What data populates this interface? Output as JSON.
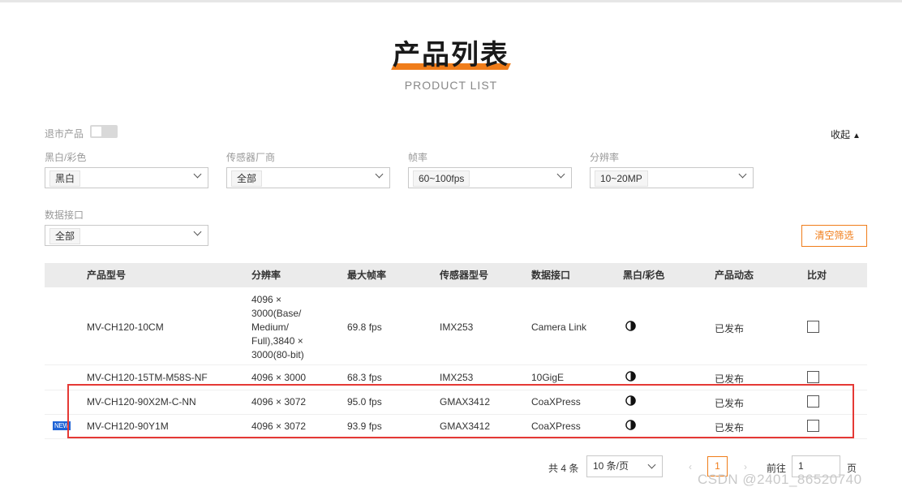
{
  "header": {
    "title": "产品列表",
    "subtitle": "PRODUCT LIST"
  },
  "filters": {
    "discontinued_label": "退市产品",
    "collapse_label": "收起",
    "collapse_icon": "triangle-up-icon",
    "mono_color": {
      "label": "黑白/彩色",
      "value": "黑白"
    },
    "sensor_maker": {
      "label": "传感器厂商",
      "value": "全部"
    },
    "frame_rate": {
      "label": "帧率",
      "value": "60~100fps"
    },
    "resolution": {
      "label": "分辨率",
      "value": "10~20MP"
    },
    "interface": {
      "label": "数据接口",
      "value": "全部"
    },
    "clear_label": "清空筛选"
  },
  "table": {
    "headers": {
      "model": "产品型号",
      "resolution": "分辨率",
      "max_fps": "最大帧率",
      "sensor": "传感器型号",
      "interface": "数据接口",
      "mono_color": "黑白/彩色",
      "status": "产品动态",
      "compare": "比对"
    },
    "rows": [
      {
        "model": "MV-CH120-10CM",
        "resolution_lines": [
          "4096 ×",
          "3000(Base/",
          "Medium/",
          "Full),3840 ×",
          "3000(80-bit)"
        ],
        "max_fps": "69.8 fps",
        "sensor": "IMX253",
        "interface": "Camera Link",
        "status": "已发布"
      },
      {
        "model": "MV-CH120-15TM-M58S-NF",
        "resolution": "4096 × 3000",
        "max_fps": "68.3 fps",
        "sensor": "IMX253",
        "interface": "10GigE",
        "status": "已发布"
      },
      {
        "model": "MV-CH120-90X2M-C-NN",
        "resolution": "4096 × 3072",
        "max_fps": "95.0 fps",
        "sensor": "GMAX3412",
        "interface": "CoaXPress",
        "status": "已发布"
      },
      {
        "badge": "NEW",
        "model": "MV-CH120-90Y1M",
        "resolution": "4096 × 3072",
        "max_fps": "93.9 fps",
        "sensor": "GMAX3412",
        "interface": "CoaXPress",
        "status": "已发布"
      }
    ]
  },
  "pagination": {
    "total": "共 4 条",
    "page_size": "10 条/页",
    "prev_icon": "chevron-left-icon",
    "next_icon": "chevron-right-icon",
    "current_page": "1",
    "goto_label": "前往",
    "goto_value": "1",
    "page_label": "页"
  },
  "watermark": "CSDN @2401_86520740",
  "colors": {
    "accent": "#f07d1a",
    "highlight_box": "#e53935",
    "new_badge": "#1e63d6"
  }
}
